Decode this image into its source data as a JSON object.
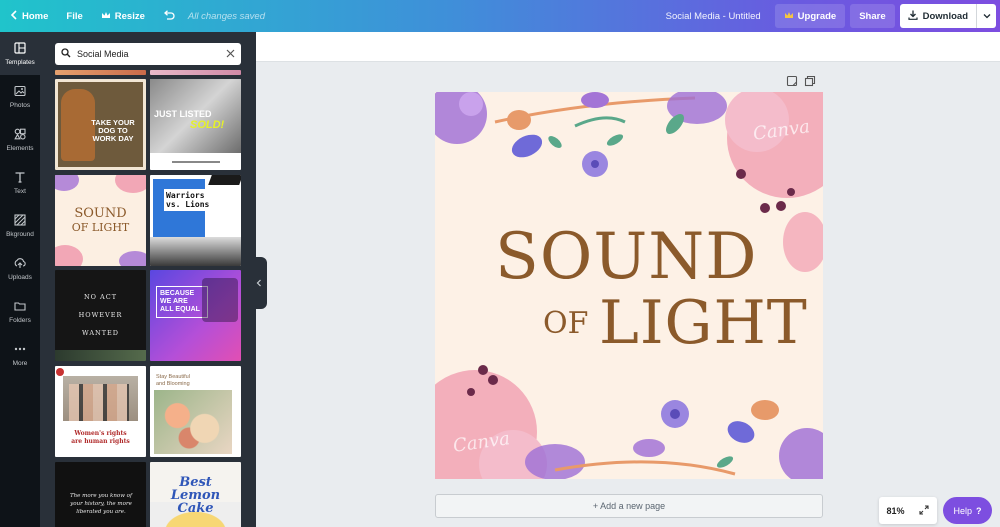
{
  "topbar": {
    "home": "Home",
    "file": "File",
    "resize": "Resize",
    "saved_status": "All changes saved",
    "doc_title": "Social Media - Untitled",
    "upgrade": "Upgrade",
    "share": "Share",
    "download": "Download"
  },
  "rail": {
    "items": [
      {
        "label": "Templates",
        "icon": "templates-icon"
      },
      {
        "label": "Photos",
        "icon": "photo-icon"
      },
      {
        "label": "Elements",
        "icon": "shapes-icon"
      },
      {
        "label": "Text",
        "icon": "text-icon"
      },
      {
        "label": "Bkground",
        "icon": "pattern-icon"
      },
      {
        "label": "Uploads",
        "icon": "upload-icon"
      },
      {
        "label": "Folders",
        "icon": "folder-icon"
      },
      {
        "label": "More",
        "icon": "more-icon"
      }
    ]
  },
  "search": {
    "value": "Social Media"
  },
  "templates": {
    "t1": [
      "TAKE YOUR",
      "DOG TO",
      "WORK DAY"
    ],
    "t2": [
      "JUST LISTED",
      "SOLD!"
    ],
    "t3": [
      "SOUND",
      "OF LIGHT"
    ],
    "t4": [
      "Warriors",
      "vs. Lions"
    ],
    "t5": [
      "NO ACT",
      "HOWEVER",
      "WANTED"
    ],
    "t6": [
      "BECAUSE",
      "WE ARE",
      "ALL EQUAL"
    ],
    "t7": [
      "Women's rights",
      "are human rights"
    ],
    "t8": [
      "Stay Beautiful",
      "and Blooming"
    ],
    "t9": [
      "The more you know of",
      "your history, the more",
      "liberated you are."
    ],
    "t10": [
      "Best",
      "Lemon",
      "Cake"
    ]
  },
  "design": {
    "line1": "SOUND",
    "line2_small": "OF",
    "line2": "LIGHT",
    "watermark": "Canva"
  },
  "canvas": {
    "add_page": "+ Add a new page"
  },
  "footer": {
    "zoom": "81%",
    "help": "Help",
    "help_mark": "?"
  },
  "colors": {
    "accent": "#7d4ee0",
    "title_brown": "#8b5a2b",
    "page_bg": "#fdf1e6"
  }
}
